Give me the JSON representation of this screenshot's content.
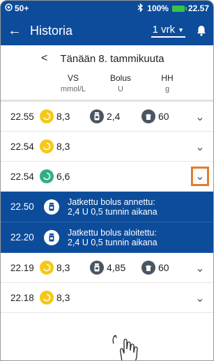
{
  "status_bar": {
    "notification_count": "50+",
    "battery_percent": "100%",
    "clock": "22.57"
  },
  "app_bar": {
    "title": "Historia",
    "range_value": "1 vrk"
  },
  "date_nav": {
    "label": "Tänään 8. tammikuuta"
  },
  "columns": [
    {
      "label": "VS",
      "unit": "mmol/L"
    },
    {
      "label": "Bolus",
      "unit": "U"
    },
    {
      "label": "HH",
      "unit": "g"
    }
  ],
  "rows": [
    {
      "time": "22.55",
      "vs": "8,3",
      "bolus": "2,4",
      "hh": "60"
    },
    {
      "time": "22.54",
      "vs": "8,3"
    },
    {
      "time": "22.54",
      "vs": "6,6"
    },
    {
      "time": "22.50",
      "message": "Jatkettu bolus annettu:\n2,4 U 0,5 tunnin aikana"
    },
    {
      "time": "22.20",
      "message": "Jatkettu bolus aloitettu:\n2,4 U 0,5 tunnin aikana"
    },
    {
      "time": "22.19",
      "vs": "8,3",
      "bolus": "4,85",
      "hh": "60"
    },
    {
      "time": "22.18",
      "vs": "8,3"
    }
  ],
  "colors": {
    "primary": "#0c4c9b",
    "glucose_high": "#f6c816",
    "glucose_in_range": "#2fae8a",
    "highlight_box": "#e27c2b"
  }
}
